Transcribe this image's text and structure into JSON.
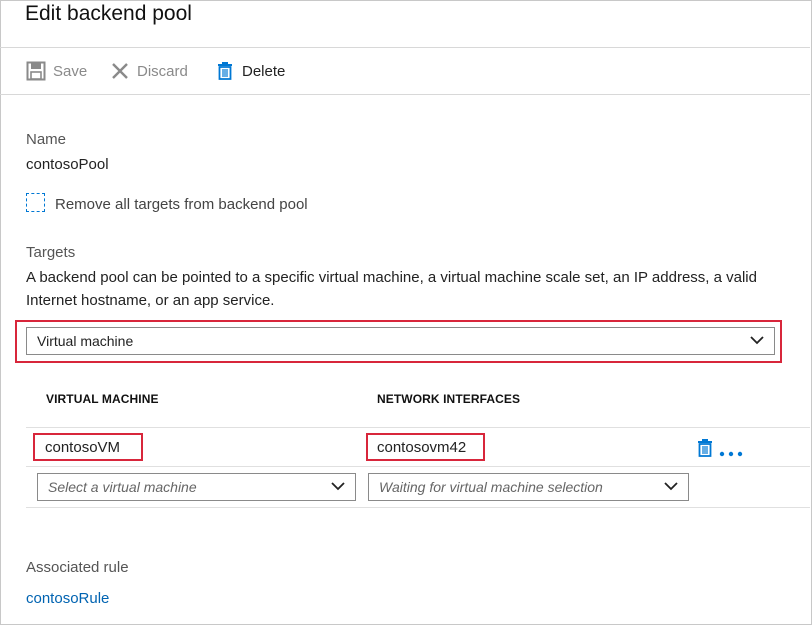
{
  "header": {
    "title": "Edit backend pool"
  },
  "toolbar": {
    "save_label": "Save",
    "discard_label": "Discard",
    "delete_label": "Delete"
  },
  "form": {
    "name_label": "Name",
    "name_value": "contosoPool",
    "remove_all_label": "Remove all targets from backend pool",
    "targets_label": "Targets",
    "targets_description": "A backend pool can be pointed to a specific virtual machine, a virtual machine scale set, an IP address, a valid Internet hostname, or an app service.",
    "target_type_selected": "Virtual machine"
  },
  "table": {
    "columns": [
      "VIRTUAL MACHINE",
      "NETWORK INTERFACES"
    ],
    "rows": [
      {
        "virtual_machine": "contosoVM",
        "network_interface": "contosovm42"
      }
    ],
    "new_row": {
      "vm_placeholder": "Select a virtual machine",
      "nic_placeholder": "Waiting for virtual machine selection"
    }
  },
  "associated": {
    "label": "Associated rule",
    "rule": "contosoRule"
  },
  "colors": {
    "accent": "#0078d4",
    "highlight": "#d8263b",
    "link": "#0063b1"
  }
}
